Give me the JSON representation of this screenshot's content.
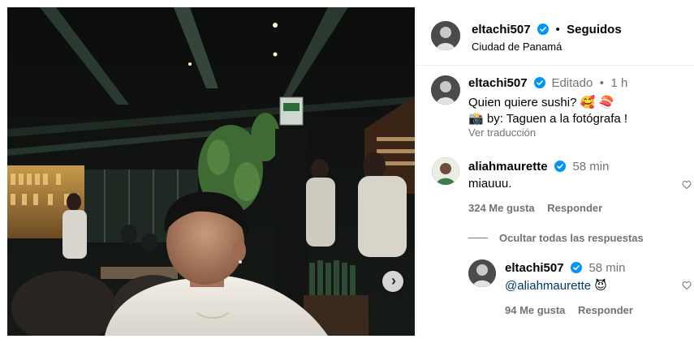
{
  "post": {
    "author": "eltachi507",
    "follow_status": "Seguidos",
    "location": "Ciudad de Panamá",
    "separator": "•"
  },
  "caption": {
    "author": "eltachi507",
    "edited_label": "Editado",
    "time": "1 h",
    "line1": "Quien quiere sushi?",
    "line1_emojis": "🥰 🍣",
    "line2_emoji": "📸",
    "line2": "by: Taguen a la fotógrafa !",
    "translate_label": "Ver traducción"
  },
  "comments": [
    {
      "author": "aliahmaurette",
      "time": "58 min",
      "text": "miauuu.",
      "likes_label": "324 Me gusta",
      "reply_label": "Responder",
      "hide_replies_label": "Ocultar todas las respuestas"
    },
    {
      "author": "eltachi507",
      "time": "58 min",
      "text": "@aliahmaurette",
      "emoji": "😈",
      "likes_label": "94 Me gusta",
      "reply_label": "Responder"
    }
  ],
  "colors": {
    "verified": "#0095f6",
    "muted": "#737373",
    "divider": "#efefef"
  },
  "icons": {
    "verified": "verified-badge-icon",
    "next": "chevron-right-icon",
    "like": "heart-icon"
  }
}
